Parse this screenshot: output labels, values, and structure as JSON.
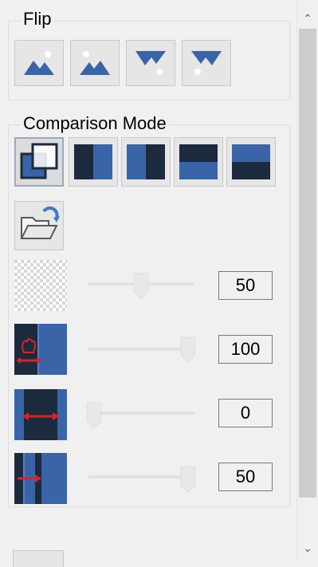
{
  "flip": {
    "title": "Flip",
    "buttons": [
      {
        "name": "flip-none",
        "icon": "image-normal-icon"
      },
      {
        "name": "flip-horizontal",
        "icon": "image-flip-horizontal-icon"
      },
      {
        "name": "flip-vertical",
        "icon": "image-flip-vertical-icon"
      },
      {
        "name": "flip-both",
        "icon": "image-flip-both-icon"
      }
    ]
  },
  "comparison": {
    "title": "Comparison Mode",
    "modes": [
      {
        "name": "overlay",
        "icon": "overlay-mode-icon",
        "selected": true
      },
      {
        "name": "split-right",
        "icon": "split-vertical-right-icon"
      },
      {
        "name": "split-left",
        "icon": "split-vertical-left-icon"
      },
      {
        "name": "split-top",
        "icon": "split-horizontal-top-icon"
      },
      {
        "name": "split-bottom",
        "icon": "split-horizontal-bottom-icon"
      }
    ],
    "open_icon": "folder-open-refresh-icon",
    "sliders": [
      {
        "name": "opacity",
        "icon": "transparency-checker-icon",
        "value": "50",
        "level": 0.5
      },
      {
        "name": "hand-position",
        "icon": "hand-drag-icon",
        "value": "100",
        "level": 1.0
      },
      {
        "name": "split-width",
        "icon": "split-width-icon",
        "value": "0",
        "level": 0.0
      },
      {
        "name": "split-offset",
        "icon": "split-offset-icon",
        "value": "50",
        "level": 1.0
      }
    ]
  },
  "colors": {
    "accent": "#3a64a8",
    "dark": "#1c2a3e",
    "arrow": "#e02020"
  }
}
